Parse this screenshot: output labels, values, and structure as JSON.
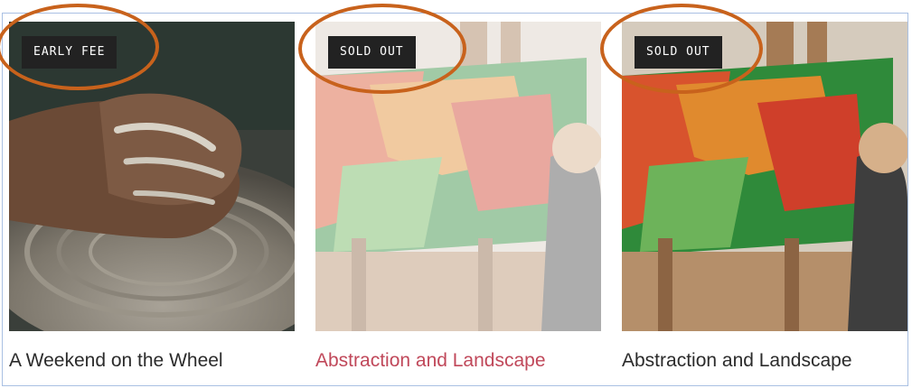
{
  "cards": [
    {
      "badge": "EARLY FEE",
      "title": "A Weekend on the Wheel",
      "image": "pottery-wheel-hands"
    },
    {
      "badge": "SOLD OUT",
      "title": "Abstraction and Landscape",
      "image": "painting-easel"
    },
    {
      "badge": "SOLD OUT",
      "title": "Abstraction and Landscape",
      "image": "painting-easel"
    }
  ],
  "colors": {
    "badge_bg": "#222222",
    "title_hover": "#c0485a",
    "highlight_ring": "#c8621c",
    "frame_border": "#a9c0e3"
  }
}
